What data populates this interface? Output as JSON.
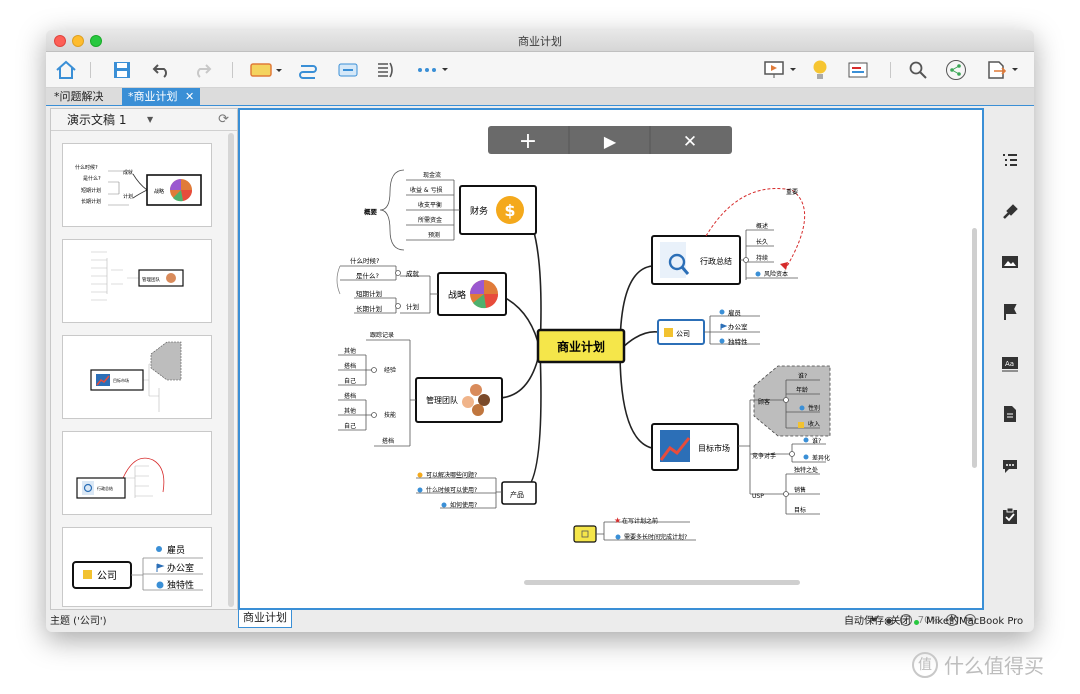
{
  "window": {
    "title": "商业计划"
  },
  "tabs": [
    {
      "label": "*问题解决"
    },
    {
      "label": "*商业计划",
      "close": "✕"
    }
  ],
  "left_panel": {
    "title": "演示文稿 1"
  },
  "thumb_texts": {
    "t1": [
      "什么时候?",
      "是什么?",
      "短期计划",
      "长期计划",
      "成就",
      "计划",
      "战略"
    ],
    "t2": [
      "管理团队"
    ],
    "t3": [
      "目标市场"
    ],
    "t4": [
      "行政总结"
    ],
    "t5": [
      "公司",
      "雇员",
      "办公室",
      "独特性"
    ]
  },
  "float_toolbar": {
    "plus": "+",
    "play": "▶",
    "close": "✕"
  },
  "mindmap": {
    "central": "商业计划",
    "finance": {
      "label": "财务",
      "tag": "概要",
      "items": [
        "现金流",
        "收益 & 亏损",
        "收支平衡",
        "所需资金",
        "预测"
      ]
    },
    "strategy": {
      "label": "战略",
      "items": [
        "什么时候?",
        "是什么?",
        "短期计划",
        "长期计划"
      ],
      "groups": [
        "成就",
        "计划"
      ]
    },
    "team": {
      "label": "管理团队",
      "items": [
        "跟踪记录",
        "其他",
        "搭档",
        "自己",
        "搭档",
        "其他",
        "自己",
        "搭档"
      ],
      "groups": [
        "经验",
        "技能"
      ]
    },
    "product": {
      "label": "产品",
      "items": [
        "可以解决哪些问题?",
        "什么时候可以使用?",
        "如何使用?"
      ]
    },
    "exec": {
      "label": "行政总结",
      "items": [
        "概述",
        "长久",
        "持续",
        "风险资本"
      ],
      "note": "重要"
    },
    "company": {
      "label": "公司",
      "items": [
        "雇员",
        "办公室",
        "独特性"
      ]
    },
    "market": {
      "label": "目标市场",
      "groups": [
        "顾客",
        "竞争对手",
        "USP"
      ],
      "customer_items": [
        "谁?",
        "年龄",
        "性别",
        "收入"
      ],
      "competitor_items": [
        "谁?",
        "差异化"
      ],
      "usp_items": [
        "独特之处",
        "销售",
        "目标"
      ]
    },
    "floating": {
      "items": [
        "在写计划之前",
        "需要多长时间完成计划?"
      ]
    }
  },
  "sheet_tab": "商业计划",
  "zoom": {
    "level": "70%",
    "minus": "−",
    "plus": "+"
  },
  "status": {
    "topic": "主题 ('公司')",
    "autosave": "自动保存: 关闭",
    "device": "Mike的MacBook Pro"
  },
  "watermark": "什么值得买",
  "colors": {
    "accent": "#3a8fd6",
    "central_fill": "#f5e64a",
    "red_line": "#d62b2b"
  }
}
